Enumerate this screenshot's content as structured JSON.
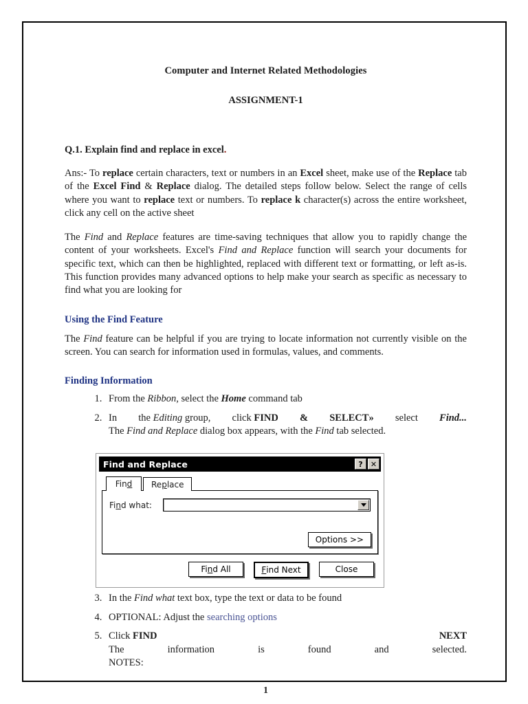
{
  "document": {
    "title": "Computer and Internet Related Methodologies",
    "subtitle": "ASSIGNMENT-1",
    "page_number": "1"
  },
  "question": {
    "heading_text": "Q.1. Explain find and replace in excel",
    "heading_end_dot": "."
  },
  "answer": {
    "para1": {
      "s1": "Ans:- To ",
      "b1": "replace",
      "s2": " certain characters, text or numbers in an ",
      "b2": "Excel",
      "s3": " sheet, make use of the ",
      "b3": "Replace",
      "s4": " tab of the ",
      "b4": "Excel Find",
      "s5": " & ",
      "b5": "Replace",
      "s6": " dialog. The detailed steps follow below. Select the range of cells where you want to ",
      "b6": "replace",
      "s7": " text or numbers. To ",
      "b7": "replace",
      "s8": "  ",
      "b8": "k",
      "s9": " character(s) across the entire worksheet, click any cell on the active sheet"
    },
    "para2": {
      "s1": "The ",
      "i1": "Find",
      "s2": " and ",
      "i2": "Replace",
      "s3": " features are time-saving techniques that allow you to rapidly change the content of your worksheets. Excel's ",
      "i3": "Find and Replace",
      "s4": " function will search your documents for specific text, which can then be highlighted, replaced with different text or formatting, or left as-is. This function provides many advanced options to help make your search as specific as necessary to find what you are looking for"
    }
  },
  "sections": {
    "using_find_feature": {
      "heading": "Using the Find Feature",
      "para": {
        "s1": "The ",
        "i1": "Find",
        "s2": " feature can be helpful if you are trying to locate information not currently visible on the screen. You can search for information used in formulas, values, and comments."
      }
    },
    "finding_information": {
      "heading": "Finding Information"
    }
  },
  "steps": {
    "step1": {
      "s1": "From the ",
      "i1": "Ribbon",
      "s2": ", select the ",
      "bi1": "Home",
      "s3": " command tab"
    },
    "step2": {
      "w1": "In",
      "w2": "the",
      "wi2": "Editing",
      "w3": "group,",
      "w4": "click",
      "wb1": "FIND",
      "wb2": "&",
      "wb3": "SELECT»",
      "w5": "select",
      "wbi1": "Find...",
      "line2_s1": "The ",
      "line2_i1": "Find and Replace",
      "line2_s2": " dialog box appears, with the ",
      "line2_i2": "Find",
      "line2_s3": " tab selected."
    },
    "step3": {
      "s1": "In the ",
      "i1": "Find what",
      "s2": " text box, type the text or data to be found"
    },
    "step4": {
      "s1": "OPTIONAL: Adjust the ",
      "link": "searching options"
    },
    "step5": {
      "s1": "Click ",
      "b1": "FIND",
      "b2": "NEXT",
      "w1": "The",
      "w2": "information",
      "w3": "is",
      "w4": "found",
      "w5": "and",
      "w6": "selected.",
      "notes": "NOTES:"
    }
  },
  "dialog": {
    "title": "Find and Replace",
    "help_button": "?",
    "close_button": "✕",
    "tabs": [
      {
        "label_a": "Fin",
        "label_u": "d",
        "label_b": "",
        "active": true
      },
      {
        "label_a": "Re",
        "label_u": "p",
        "label_b": "lace",
        "active": false
      }
    ],
    "tab_find_a": "Fin",
    "tab_find_u": "d",
    "tab_replace_a": "Re",
    "tab_replace_u": "p",
    "tab_replace_b": "lace",
    "field_label_a": "Fi",
    "field_label_u": "n",
    "field_label_b": "d what:",
    "find_what_value": "",
    "find_what_placeholder": "",
    "options_button": "Options >>",
    "find_all_a": "Fi",
    "find_all_u": "n",
    "find_all_b": "d All",
    "find_next_u": "F",
    "find_next_b": "ind Next",
    "close_label": "Close"
  },
  "colors": {
    "heading_blue": "#1f3383",
    "link_blue": "#4a5494",
    "red_dot": "#8c1a12",
    "titlebar_bg": "#000000"
  }
}
